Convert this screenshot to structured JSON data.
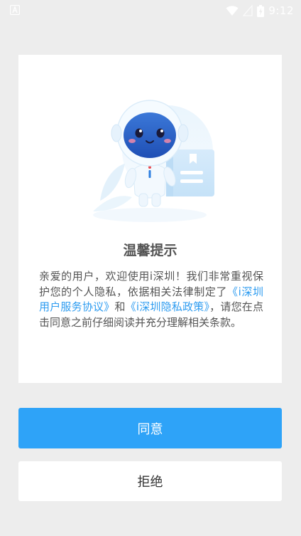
{
  "status_bar": {
    "time": "9:12",
    "icons": [
      "notification-a-icon",
      "wifi-icon",
      "signal-icon",
      "battery-icon"
    ]
  },
  "dialog": {
    "title": "温馨提示",
    "body_parts": {
      "text_1": "亲爱的用户，欢迎使用i深圳！我们非常重视保护您的个人隐私，依据相关法律制定了",
      "link_1": "《i深圳用户服务协议》",
      "text_2": "和",
      "link_2": "《i深圳隐私政策》",
      "text_3": "，请您在点击同意之前仔细阅读并充分理解相关条款。"
    }
  },
  "buttons": {
    "agree_label": "同意",
    "refuse_label": "拒绝"
  },
  "colors": {
    "accent": "#2ea3f8",
    "link": "#2e9cf0",
    "background": "#ededed",
    "text": "#555555"
  }
}
